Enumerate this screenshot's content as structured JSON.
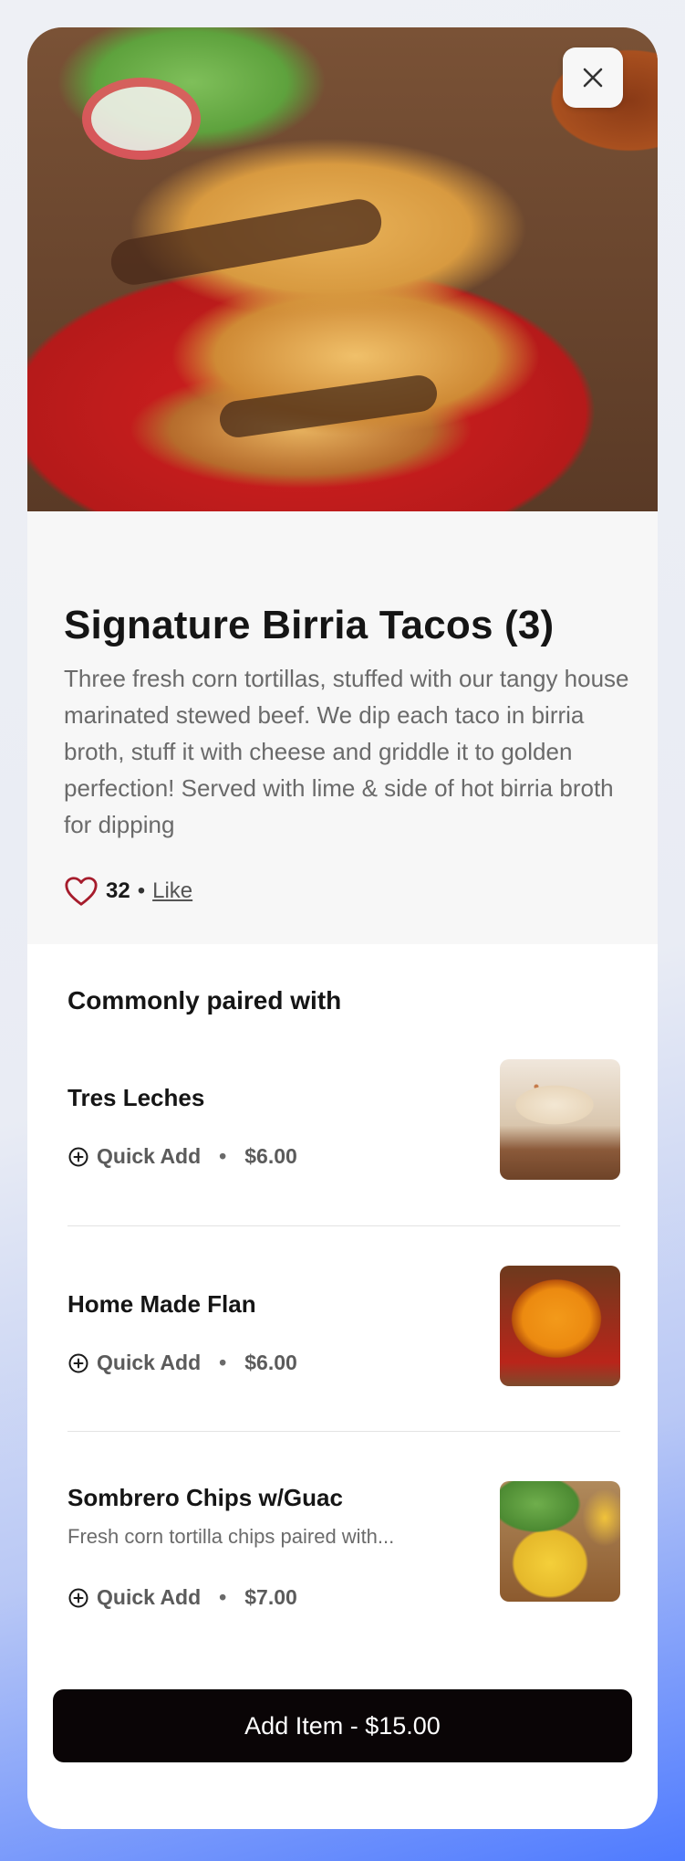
{
  "item": {
    "title": "Signature Birria Tacos (3)",
    "description": "Three fresh corn tortillas, stuffed with our tangy house marinated stewed beef. We dip each taco in birria broth, stuff it with cheese and griddle it to golden perfection! Served with lime & side of hot birria broth for dipping",
    "likes": {
      "count": "32",
      "separator": "•",
      "like_label": "Like"
    }
  },
  "paired": {
    "heading": "Commonly paired with",
    "items": [
      {
        "name": "Tres Leches",
        "subtitle": "",
        "quick_add": "Quick Add",
        "separator": "•",
        "price": "$6.00",
        "image_icon": "tres-leches-photo"
      },
      {
        "name": "Home Made Flan",
        "subtitle": "",
        "quick_add": "Quick Add",
        "separator": "•",
        "price": "$6.00",
        "image_icon": "flan-photo"
      },
      {
        "name": "Sombrero Chips w/Guac",
        "subtitle": "Fresh corn tortilla chips paired with...",
        "quick_add": "Quick Add",
        "separator": "•",
        "price": "$7.00",
        "image_icon": "chips-guac-photo"
      }
    ]
  },
  "cta": {
    "label": "Add Item - $15.00"
  },
  "icons": {
    "close": "close-icon",
    "heart": "heart-icon",
    "quick_add": "plus-circle-icon"
  },
  "colors": {
    "heart": "#a61c2c",
    "cta_bg": "#0a0506",
    "cta_text": "#ffffff",
    "info_bg": "#f7f7f7"
  }
}
